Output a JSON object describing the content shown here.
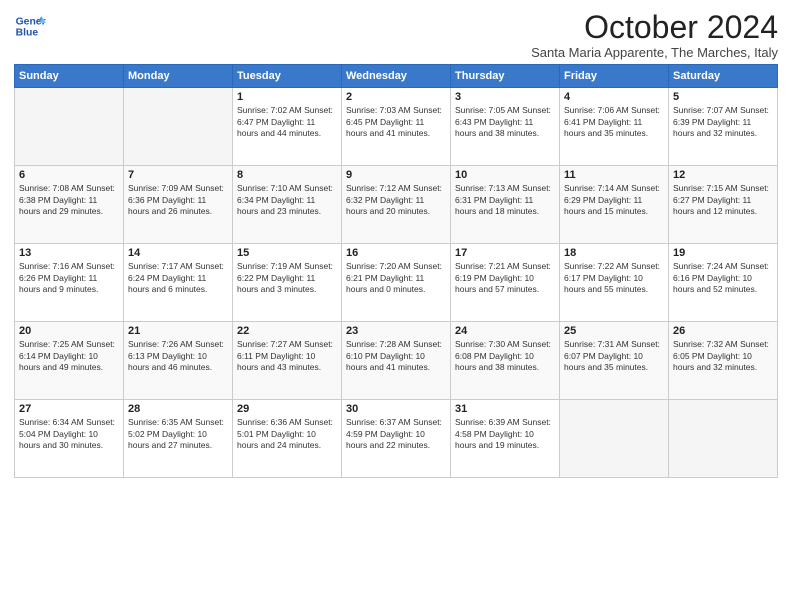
{
  "header": {
    "logo_line1": "General",
    "logo_line2": "Blue",
    "month": "October 2024",
    "location": "Santa Maria Apparente, The Marches, Italy"
  },
  "weekdays": [
    "Sunday",
    "Monday",
    "Tuesday",
    "Wednesday",
    "Thursday",
    "Friday",
    "Saturday"
  ],
  "weeks": [
    [
      {
        "day": "",
        "info": ""
      },
      {
        "day": "",
        "info": ""
      },
      {
        "day": "1",
        "info": "Sunrise: 7:02 AM\nSunset: 6:47 PM\nDaylight: 11 hours and 44 minutes."
      },
      {
        "day": "2",
        "info": "Sunrise: 7:03 AM\nSunset: 6:45 PM\nDaylight: 11 hours and 41 minutes."
      },
      {
        "day": "3",
        "info": "Sunrise: 7:05 AM\nSunset: 6:43 PM\nDaylight: 11 hours and 38 minutes."
      },
      {
        "day": "4",
        "info": "Sunrise: 7:06 AM\nSunset: 6:41 PM\nDaylight: 11 hours and 35 minutes."
      },
      {
        "day": "5",
        "info": "Sunrise: 7:07 AM\nSunset: 6:39 PM\nDaylight: 11 hours and 32 minutes."
      }
    ],
    [
      {
        "day": "6",
        "info": "Sunrise: 7:08 AM\nSunset: 6:38 PM\nDaylight: 11 hours and 29 minutes."
      },
      {
        "day": "7",
        "info": "Sunrise: 7:09 AM\nSunset: 6:36 PM\nDaylight: 11 hours and 26 minutes."
      },
      {
        "day": "8",
        "info": "Sunrise: 7:10 AM\nSunset: 6:34 PM\nDaylight: 11 hours and 23 minutes."
      },
      {
        "day": "9",
        "info": "Sunrise: 7:12 AM\nSunset: 6:32 PM\nDaylight: 11 hours and 20 minutes."
      },
      {
        "day": "10",
        "info": "Sunrise: 7:13 AM\nSunset: 6:31 PM\nDaylight: 11 hours and 18 minutes."
      },
      {
        "day": "11",
        "info": "Sunrise: 7:14 AM\nSunset: 6:29 PM\nDaylight: 11 hours and 15 minutes."
      },
      {
        "day": "12",
        "info": "Sunrise: 7:15 AM\nSunset: 6:27 PM\nDaylight: 11 hours and 12 minutes."
      }
    ],
    [
      {
        "day": "13",
        "info": "Sunrise: 7:16 AM\nSunset: 6:26 PM\nDaylight: 11 hours and 9 minutes."
      },
      {
        "day": "14",
        "info": "Sunrise: 7:17 AM\nSunset: 6:24 PM\nDaylight: 11 hours and 6 minutes."
      },
      {
        "day": "15",
        "info": "Sunrise: 7:19 AM\nSunset: 6:22 PM\nDaylight: 11 hours and 3 minutes."
      },
      {
        "day": "16",
        "info": "Sunrise: 7:20 AM\nSunset: 6:21 PM\nDaylight: 11 hours and 0 minutes."
      },
      {
        "day": "17",
        "info": "Sunrise: 7:21 AM\nSunset: 6:19 PM\nDaylight: 10 hours and 57 minutes."
      },
      {
        "day": "18",
        "info": "Sunrise: 7:22 AM\nSunset: 6:17 PM\nDaylight: 10 hours and 55 minutes."
      },
      {
        "day": "19",
        "info": "Sunrise: 7:24 AM\nSunset: 6:16 PM\nDaylight: 10 hours and 52 minutes."
      }
    ],
    [
      {
        "day": "20",
        "info": "Sunrise: 7:25 AM\nSunset: 6:14 PM\nDaylight: 10 hours and 49 minutes."
      },
      {
        "day": "21",
        "info": "Sunrise: 7:26 AM\nSunset: 6:13 PM\nDaylight: 10 hours and 46 minutes."
      },
      {
        "day": "22",
        "info": "Sunrise: 7:27 AM\nSunset: 6:11 PM\nDaylight: 10 hours and 43 minutes."
      },
      {
        "day": "23",
        "info": "Sunrise: 7:28 AM\nSunset: 6:10 PM\nDaylight: 10 hours and 41 minutes."
      },
      {
        "day": "24",
        "info": "Sunrise: 7:30 AM\nSunset: 6:08 PM\nDaylight: 10 hours and 38 minutes."
      },
      {
        "day": "25",
        "info": "Sunrise: 7:31 AM\nSunset: 6:07 PM\nDaylight: 10 hours and 35 minutes."
      },
      {
        "day": "26",
        "info": "Sunrise: 7:32 AM\nSunset: 6:05 PM\nDaylight: 10 hours and 32 minutes."
      }
    ],
    [
      {
        "day": "27",
        "info": "Sunrise: 6:34 AM\nSunset: 5:04 PM\nDaylight: 10 hours and 30 minutes."
      },
      {
        "day": "28",
        "info": "Sunrise: 6:35 AM\nSunset: 5:02 PM\nDaylight: 10 hours and 27 minutes."
      },
      {
        "day": "29",
        "info": "Sunrise: 6:36 AM\nSunset: 5:01 PM\nDaylight: 10 hours and 24 minutes."
      },
      {
        "day": "30",
        "info": "Sunrise: 6:37 AM\nSunset: 4:59 PM\nDaylight: 10 hours and 22 minutes."
      },
      {
        "day": "31",
        "info": "Sunrise: 6:39 AM\nSunset: 4:58 PM\nDaylight: 10 hours and 19 minutes."
      },
      {
        "day": "",
        "info": ""
      },
      {
        "day": "",
        "info": ""
      }
    ]
  ]
}
